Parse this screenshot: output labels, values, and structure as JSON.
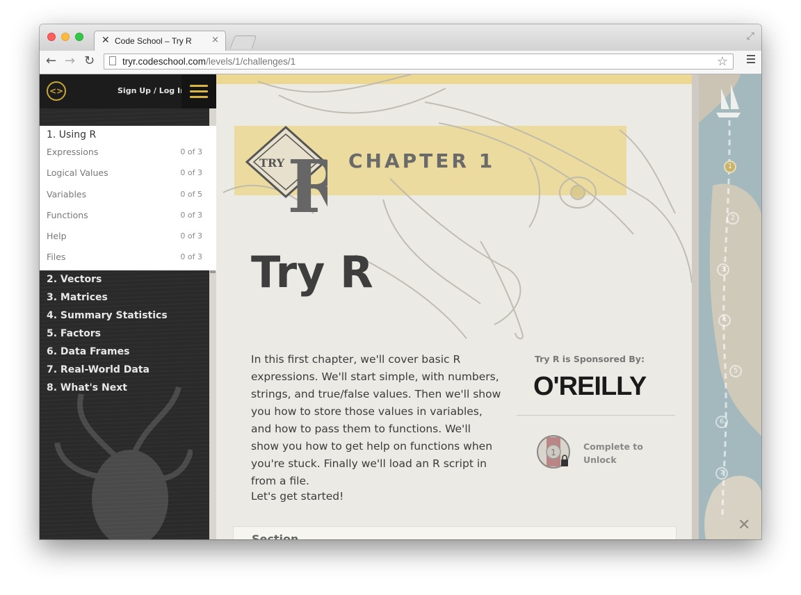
{
  "browser": {
    "tab_title": "Code School – Try R",
    "url_host": "tryr.codeschool.com",
    "url_path": "/levels/1/challenges/1"
  },
  "header": {
    "signup_label": "Sign Up / Log In"
  },
  "sidebar": {
    "current_chapter": "1. Using R",
    "lessons": [
      {
        "label": "Expressions",
        "count": "0 of 3"
      },
      {
        "label": "Logical Values",
        "count": "0 of 3"
      },
      {
        "label": "Variables",
        "count": "0 of 5"
      },
      {
        "label": "Functions",
        "count": "0 of 3"
      },
      {
        "label": "Help",
        "count": "0 of 3"
      },
      {
        "label": "Files",
        "count": "0 of 3"
      }
    ],
    "chapters": [
      "2. Vectors",
      "3. Matrices",
      "4. Summary Statistics",
      "5. Factors",
      "6. Data Frames",
      "7. Real-World Data",
      "8. What's Next"
    ]
  },
  "main": {
    "chapter_label": "CHAPTER 1",
    "title": "Try R",
    "intro": "In this first chapter, we'll cover basic R expressions. We'll start simple, with numbers, strings, and true/false values. Then we'll show you how to store those values in variables, and how to pass them to functions. We'll show you how to get help on functions when you're stuck. Finally we'll load an R script in from a file.",
    "cta": "Let's get started!",
    "sponsor_title": "Try R is Sponsored By:",
    "sponsor_name": "O'REILLY",
    "unlock_text": "Complete to Unlock",
    "badge_number": "1",
    "section_label": "Section"
  },
  "map": {
    "nodes": [
      "1",
      "2",
      "3",
      "4",
      "5",
      "6",
      "7"
    ]
  },
  "colors": {
    "accent": "#d8b443",
    "sidebar_bg": "#2a2a2a",
    "band": "#ecd892"
  }
}
